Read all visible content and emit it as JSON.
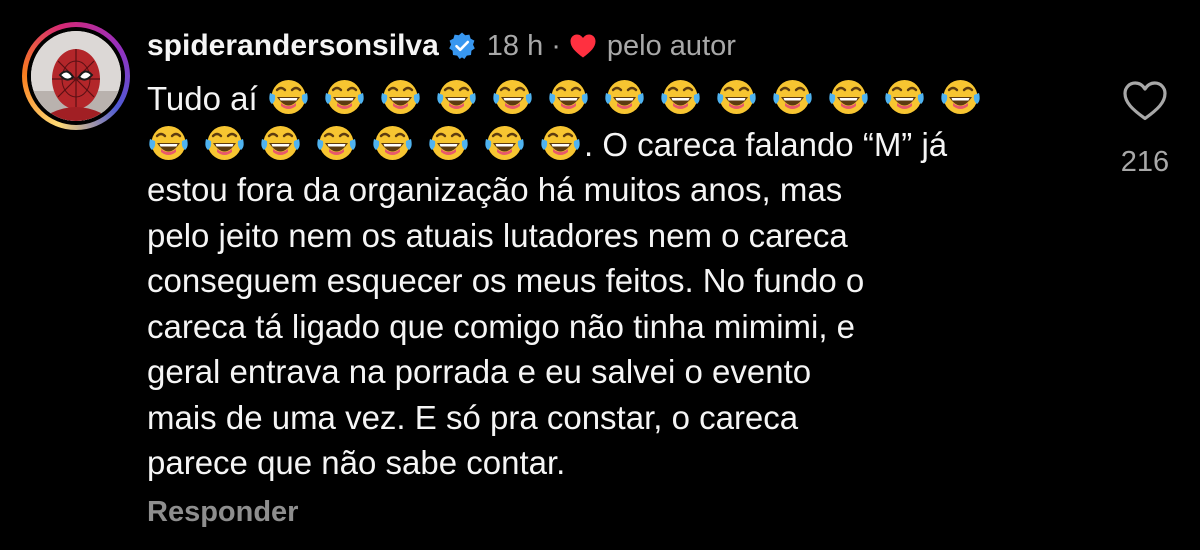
{
  "comment": {
    "author": {
      "username": "spiderandersonsilva",
      "verified": true,
      "avatar_icon": "spiderman-avatar"
    },
    "time_ago": "18 h",
    "separator": "·",
    "liked_by_author_label": "pelo autor",
    "liked_by_author_icon": "heart-filled-icon",
    "accent_heart_color": "#ff3040",
    "verified_color": "#3897f0",
    "text_prefix": "Tudo aí ",
    "emoji_first_line_count": 13,
    "emoji_second_line_count": 8,
    "emoji_name": "face-with-tears-of-joy",
    "text_lines": [
      ". O careca falando “M” já",
      "estou fora da organização há muitos anos, mas",
      "pelo jeito nem os atuais lutadores nem o careca",
      "conseguem esquecer os meus feitos. No fundo o",
      "careca tá ligado que comigo não tinha mimimi, e",
      "geral entrava na porrada e eu salvei o evento",
      "mais de uma vez. E só pra constar, o careca",
      "parece que não sabe contar."
    ],
    "reply_label": "Responder",
    "like_count": "216",
    "like_icon": "heart-outline-icon"
  }
}
